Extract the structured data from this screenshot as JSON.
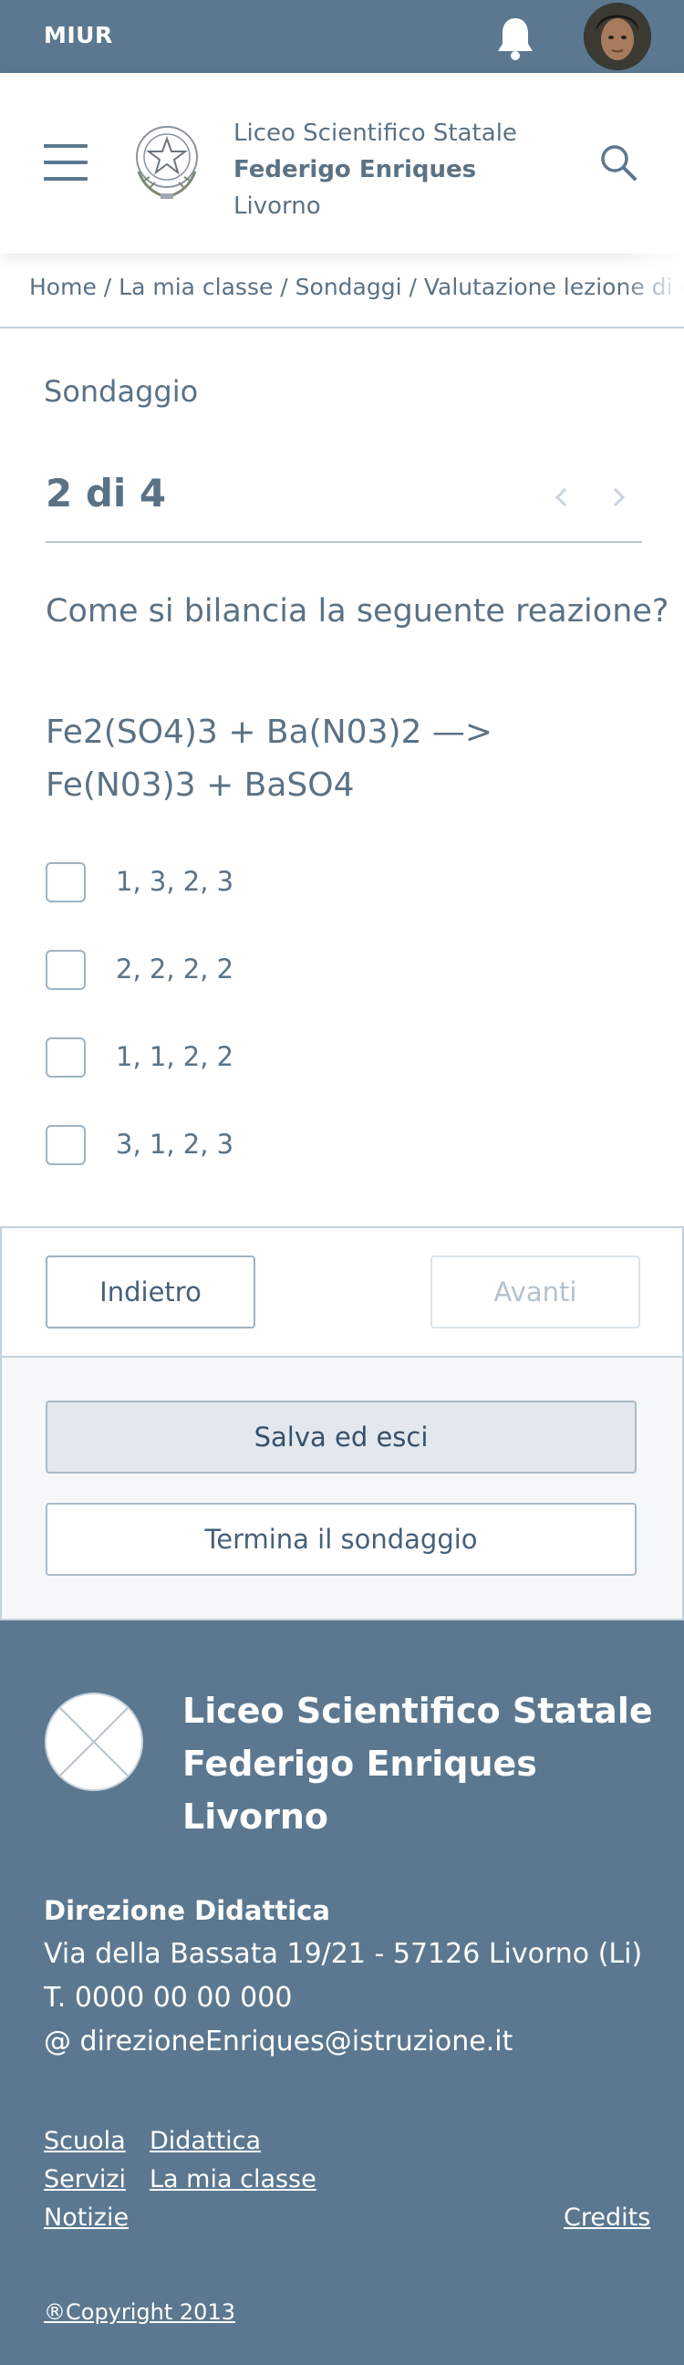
{
  "topbar": {
    "brand": "MIUR",
    "bell_icon": "bell-icon",
    "avatar": "user-avatar"
  },
  "header": {
    "menu_icon": "hamburger-menu-icon",
    "emblem": "italian-republic-emblem",
    "school": {
      "line1": "Liceo Scientifico Statale",
      "line2": "Federigo Enriques",
      "line3": "Livorno"
    },
    "search_icon": "search-icon"
  },
  "breadcrumb": {
    "text": "Home / La mia classe / Sondaggi / Valutazione lezione di c"
  },
  "survey": {
    "label": "Sondaggio",
    "step": "2 di 4",
    "question": "Come si bilancia la seguente reazione?",
    "formula": "Fe2(SO4)3 + Ba(N03)2 —> Fe(N03)3 + BaSO4",
    "options": [
      {
        "label": "1, 3, 2, 3",
        "checked": false
      },
      {
        "label": "2, 2, 2, 2",
        "checked": false
      },
      {
        "label": "1, 1, 2, 2",
        "checked": false
      },
      {
        "label": "3, 1, 2, 3",
        "checked": false
      }
    ]
  },
  "nav": {
    "back": "Indietro",
    "next": "Avanti"
  },
  "actions": {
    "save": "Salva ed esci",
    "end": "Termina il sondaggio"
  },
  "footer": {
    "title": {
      "line1": "Liceo Scientifico Statale",
      "line2": "Federigo Enriques",
      "line3": "Livorno"
    },
    "contacts": {
      "head": "Direzione Didattica",
      "address": "Via della Bassata 19/21 - 57126 Livorno (Li)",
      "phone": "T. 0000 00 00 000",
      "email": "@ direzioneEnriques@istruzione.it"
    },
    "links": {
      "scuola": "Scuola",
      "didattica": "Didattica",
      "servizi": "Servizi",
      "mia_classe": "La mia classe",
      "notizie": "Notizie",
      "credits": "Credits"
    },
    "copyright": "®Copyright 2013"
  },
  "colors": {
    "primary": "#5b7890",
    "text": "#5b7285",
    "border": "#c4d2dc"
  }
}
